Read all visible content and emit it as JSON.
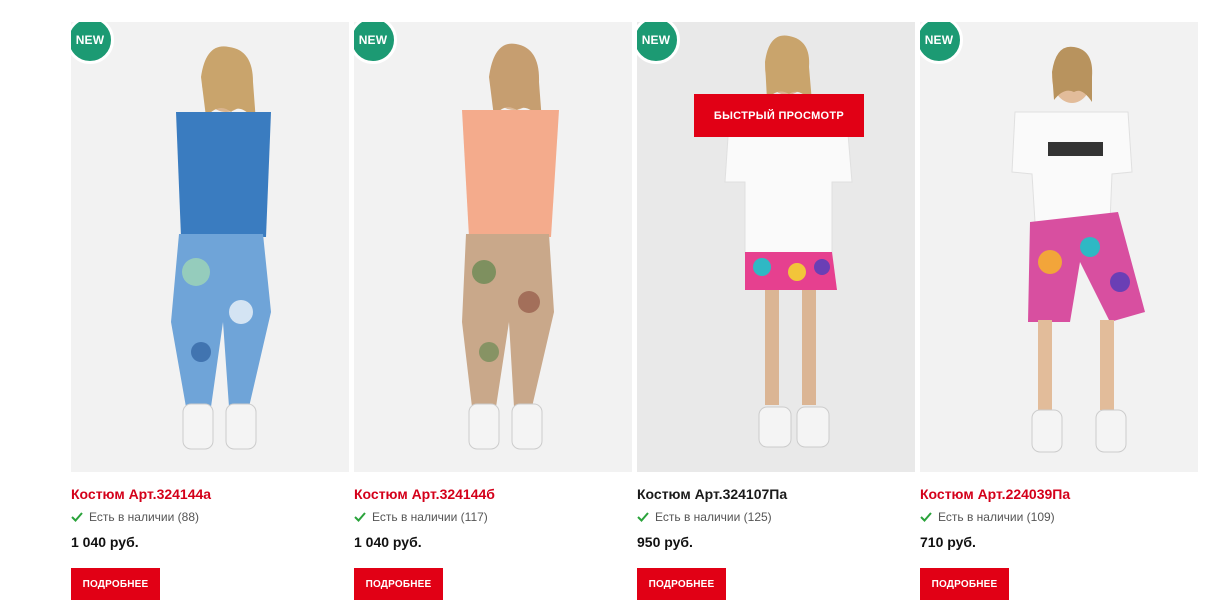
{
  "products": [
    {
      "badge": "NEW",
      "title": "Костюм Арт.324144а",
      "stock": "Есть в наличии (88)",
      "price": "1 040 руб.",
      "button": "ПОДРОБНЕЕ",
      "top_color": "#3a7cc0",
      "bottom_color": "#6fa4d8",
      "bottom_accent": "#9fd6b5"
    },
    {
      "badge": "NEW",
      "title": "Костюм Арт.324144б",
      "stock": "Есть в наличии (117)",
      "price": "1 040 руб.",
      "button": "ПОДРОБНЕЕ",
      "top_color": "#f4ab8c",
      "bottom_color": "#c9a88a",
      "bottom_accent": "#6b8a54"
    },
    {
      "badge": "NEW",
      "title": "Костюм Арт.324107Па",
      "stock": "Есть в наличии (125)",
      "price": "950 руб.",
      "button": "ПОДРОБНЕЕ",
      "quick_view": "БЫСТРЫЙ ПРОСМОТР",
      "top_color": "#fafafa",
      "bottom_color": "#e6408f",
      "bottom_accent": "#2fb8c4"
    },
    {
      "badge": "NEW",
      "title": "Костюм Арт.224039Па",
      "stock": "Есть в наличии (109)",
      "price": "710 руб.",
      "button": "ПОДРОБНЕЕ",
      "top_color": "#fafafa",
      "bottom_color": "#d84fa0",
      "bottom_accent": "#f2a53a"
    }
  ],
  "colors": {
    "accent_red": "#e10015",
    "title_red": "#d4001a",
    "badge_green": "#1c9a73",
    "check_green": "#2aa33b"
  }
}
